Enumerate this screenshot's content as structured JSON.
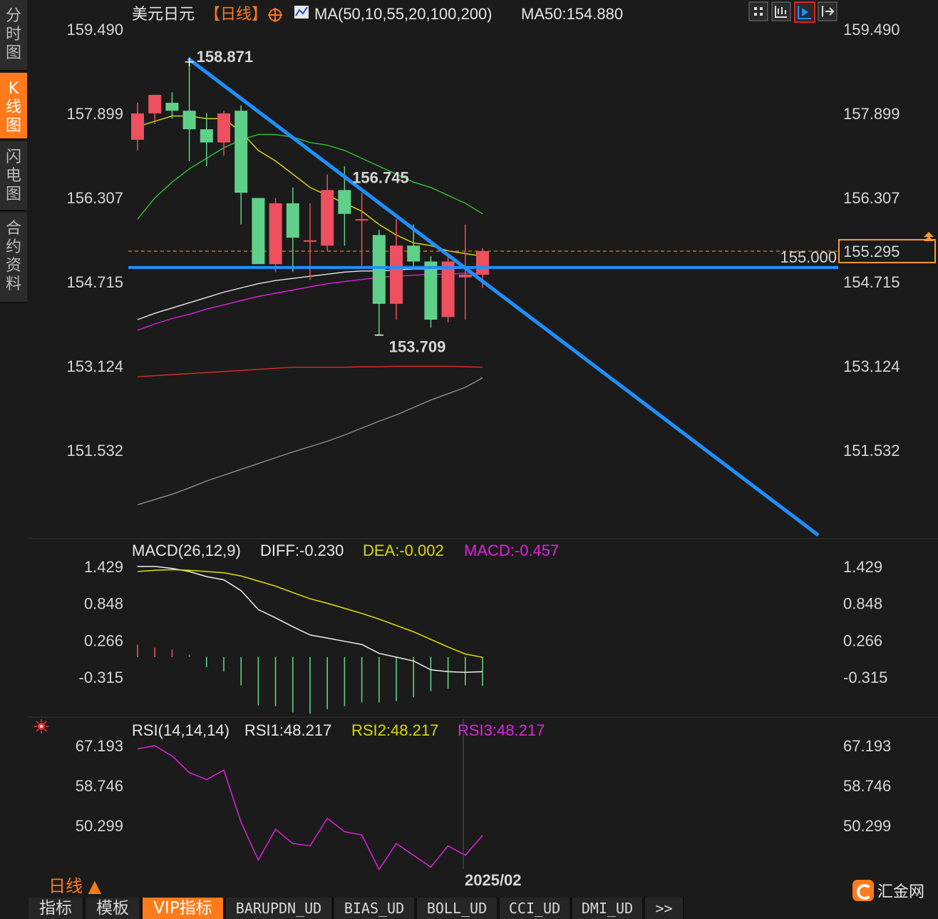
{
  "sidebar": {
    "tabs": [
      {
        "label": "分\n时\n图",
        "active": false
      },
      {
        "label": "K\n线\n图",
        "active": true
      },
      {
        "label": "闪\n电\n图",
        "active": false
      },
      {
        "label": "合\n约\n资\n料",
        "active": false
      }
    ]
  },
  "header": {
    "symbol": "美元日元",
    "period_tag": "【日线】",
    "ma_params": "MA(50,10,55,20,100,200)",
    "ma_value": "MA50:154.880"
  },
  "toolbar": {
    "icons": [
      "grid-layout-icon",
      "indicator-layout-icon",
      "chart-mode-icon",
      "shift-right-icon"
    ],
    "active_index": 2
  },
  "price_axis": {
    "ticks": [
      "159.490",
      "157.899",
      "156.307",
      "154.715",
      "153.124",
      "151.532"
    ],
    "tick_values": [
      159.49,
      157.899,
      156.307,
      154.715,
      153.124,
      151.532
    ]
  },
  "annotations": {
    "high": "158.871",
    "swing_high": "156.745",
    "low": "153.709",
    "horizontal_line_label": "155.000",
    "horizontal_line_value": 155.0,
    "current_price": "155.295",
    "current_price_value": 155.295
  },
  "candles": [
    {
      "o": 157.4,
      "h": 158.1,
      "l": 157.2,
      "c": 157.9
    },
    {
      "o": 157.9,
      "h": 158.2,
      "l": 157.7,
      "c": 158.25
    },
    {
      "o": 158.1,
      "h": 158.3,
      "l": 157.8,
      "c": 157.95
    },
    {
      "o": 157.95,
      "h": 158.871,
      "l": 157.0,
      "c": 157.6
    },
    {
      "o": 157.6,
      "h": 157.9,
      "l": 156.9,
      "c": 157.35
    },
    {
      "o": 157.35,
      "h": 157.95,
      "l": 157.1,
      "c": 157.9
    },
    {
      "o": 157.95,
      "h": 158.05,
      "l": 155.8,
      "c": 156.4
    },
    {
      "o": 156.3,
      "h": 156.3,
      "l": 155.1,
      "c": 155.05
    },
    {
      "o": 155.05,
      "h": 156.3,
      "l": 154.9,
      "c": 156.2
    },
    {
      "o": 156.2,
      "h": 156.5,
      "l": 154.9,
      "c": 155.55
    },
    {
      "o": 155.5,
      "h": 156.2,
      "l": 154.75,
      "c": 155.5
    },
    {
      "o": 155.4,
      "h": 156.745,
      "l": 155.3,
      "c": 156.45
    },
    {
      "o": 156.45,
      "h": 156.9,
      "l": 155.4,
      "c": 156.0
    },
    {
      "o": 155.9,
      "h": 156.4,
      "l": 155.0,
      "c": 155.9
    },
    {
      "o": 155.6,
      "h": 155.7,
      "l": 153.709,
      "c": 154.3
    },
    {
      "o": 154.3,
      "h": 155.9,
      "l": 154.0,
      "c": 155.4
    },
    {
      "o": 155.4,
      "h": 155.8,
      "l": 154.95,
      "c": 155.1
    },
    {
      "o": 155.1,
      "h": 155.2,
      "l": 153.85,
      "c": 154.0
    },
    {
      "o": 154.05,
      "h": 155.2,
      "l": 153.95,
      "c": 155.1
    },
    {
      "o": 154.8,
      "h": 155.8,
      "l": 154.0,
      "c": 154.85
    },
    {
      "o": 154.85,
      "h": 155.35,
      "l": 154.6,
      "c": 155.295
    }
  ],
  "ma_lines": [
    {
      "color": "#e0e000",
      "values": [
        157.65,
        157.75,
        157.85,
        157.85,
        157.8,
        157.8,
        157.55,
        157.2,
        157.0,
        156.75,
        156.5,
        156.35,
        156.2,
        156.05,
        155.8,
        155.6,
        155.45,
        155.4,
        155.3,
        155.25,
        155.2
      ]
    },
    {
      "color": "#2fc42f",
      "values": [
        155.9,
        156.3,
        156.6,
        156.85,
        157.05,
        157.25,
        157.4,
        157.5,
        157.5,
        157.45,
        157.35,
        157.3,
        157.2,
        157.05,
        156.9,
        156.75,
        156.6,
        156.5,
        156.35,
        156.2,
        156.0
      ]
    },
    {
      "color": "#e8e8e8",
      "values": [
        154.0,
        154.12,
        154.22,
        154.32,
        154.42,
        154.52,
        154.6,
        154.68,
        154.74,
        154.78,
        154.82,
        154.86,
        154.9,
        154.92,
        154.92,
        154.94,
        154.96,
        154.96,
        154.96,
        154.98,
        155.0
      ]
    },
    {
      "color": "#e020e0",
      "values": [
        153.8,
        153.92,
        154.02,
        154.1,
        154.2,
        154.28,
        154.36,
        154.44,
        154.5,
        154.56,
        154.62,
        154.68,
        154.72,
        154.76,
        154.8,
        154.82,
        154.84,
        154.86,
        154.86,
        154.88,
        154.88
      ]
    },
    {
      "color": "#e02a2a",
      "values": [
        152.92,
        152.94,
        152.96,
        152.98,
        153.0,
        153.02,
        153.04,
        153.06,
        153.08,
        153.1,
        153.1,
        153.1,
        153.1,
        153.11,
        153.11,
        153.12,
        153.12,
        153.12,
        153.12,
        153.11,
        153.1
      ]
    },
    {
      "color": "#8f8f8f",
      "values": [
        150.5,
        150.6,
        150.7,
        150.82,
        150.95,
        151.06,
        151.17,
        151.28,
        151.39,
        151.5,
        151.6,
        151.7,
        151.82,
        151.95,
        152.08,
        152.2,
        152.34,
        152.48,
        152.6,
        152.72,
        152.9
      ]
    }
  ],
  "macd": {
    "label": "MACD(26,12,9)",
    "diff": "DIFF:-0.230",
    "dea": "DEA:-0.002",
    "macd": "MACD:-0.457",
    "ticks": [
      "1.429",
      "0.848",
      "0.266",
      "-0.315"
    ],
    "tick_values": [
      1.429,
      0.848,
      0.266,
      -0.315
    ],
    "diff_values": [
      1.43,
      1.43,
      1.4,
      1.35,
      1.27,
      1.22,
      1.05,
      0.75,
      0.62,
      0.48,
      0.35,
      0.3,
      0.25,
      0.2,
      0.06,
      0.0,
      -0.06,
      -0.2,
      -0.23,
      -0.24,
      -0.23
    ],
    "dea_values": [
      1.35,
      1.37,
      1.38,
      1.37,
      1.35,
      1.33,
      1.28,
      1.2,
      1.12,
      1.02,
      0.92,
      0.85,
      0.77,
      0.69,
      0.6,
      0.5,
      0.4,
      0.28,
      0.16,
      0.05,
      -0.002
    ],
    "hist_values": [
      0.2,
      0.15,
      0.12,
      0.04,
      -0.16,
      -0.23,
      -0.45,
      -0.77,
      -0.78,
      -0.88,
      -0.9,
      -0.83,
      -0.78,
      -0.72,
      -0.72,
      -0.7,
      -0.64,
      -0.54,
      -0.5,
      -0.45,
      -0.457
    ]
  },
  "rsi": {
    "label": "RSI(14,14,14)",
    "rsi1": "RSI1:48.217",
    "rsi2": "RSI2:48.217",
    "rsi3": "RSI3:48.217",
    "ticks": [
      "67.193",
      "58.746",
      "50.299"
    ],
    "tick_values": [
      67.193,
      58.746,
      50.299
    ],
    "values": [
      66.5,
      67.2,
      65.0,
      61.5,
      60.0,
      62.0,
      51.0,
      43.0,
      49.5,
      46.5,
      46.0,
      51.8,
      49.0,
      48.3,
      41.0,
      46.5,
      44.0,
      41.5,
      46.0,
      44.0,
      48.217
    ]
  },
  "x_axis": {
    "label": "2025/02"
  },
  "period": {
    "label": "日线"
  },
  "bottom_tabs": [
    {
      "label": "指标",
      "active": false
    },
    {
      "label": "模板",
      "active": false
    },
    {
      "label": "VIP指标",
      "active": true
    },
    {
      "label": "BARUPDN_UD",
      "active": false
    },
    {
      "label": "BIAS_UD",
      "active": false
    },
    {
      "label": "BOLL_UD",
      "active": false
    },
    {
      "label": "CCI_UD",
      "active": false
    },
    {
      "label": "DMI_UD",
      "active": false
    },
    {
      "label": ">>",
      "active": false
    }
  ],
  "logo": {
    "name": "汇金网"
  },
  "colors": {
    "up": "#ef5060",
    "down": "#5fd08a",
    "trend_line": "#1e90ff",
    "accent": "#ff7a1a"
  }
}
